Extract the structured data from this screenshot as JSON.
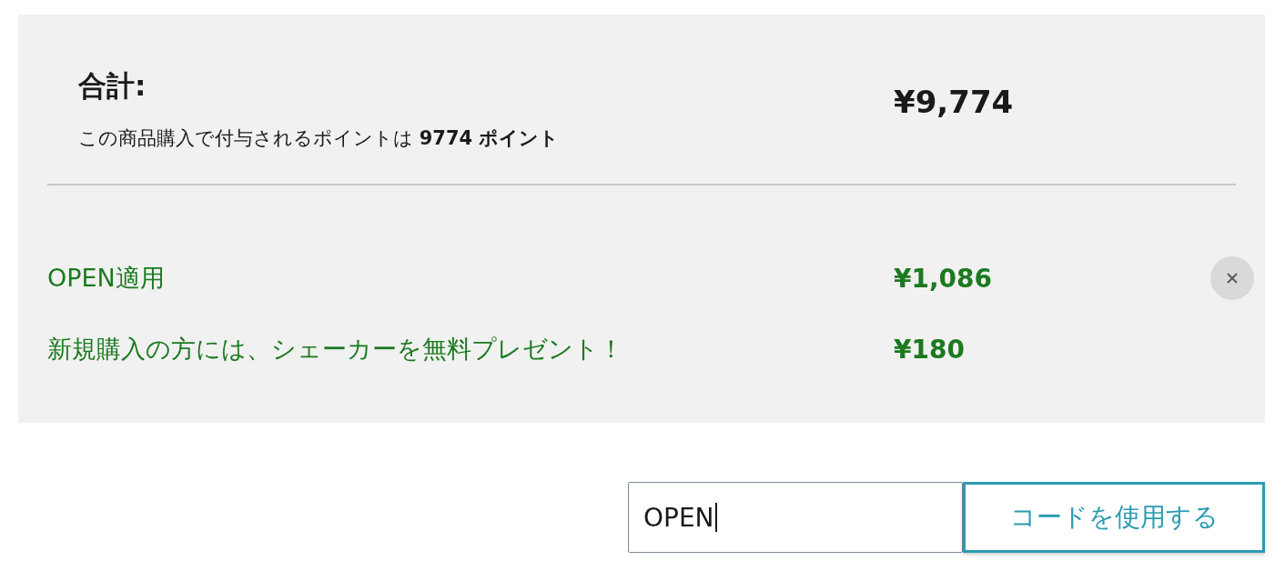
{
  "summary": {
    "title": "合計:",
    "points_note": "この商品購入で付与されるポイントは **9774 ポイント**",
    "total": "¥9,774"
  },
  "discounts": [
    {
      "label": "OPEN適用",
      "amount": "¥1,086",
      "removable": true
    },
    {
      "label": "新規購入の方には、シェーカーを無料プレゼント！",
      "amount": "¥180",
      "removable": false
    }
  ],
  "coupon": {
    "value": "OPEN",
    "button": "コードを使用する"
  }
}
